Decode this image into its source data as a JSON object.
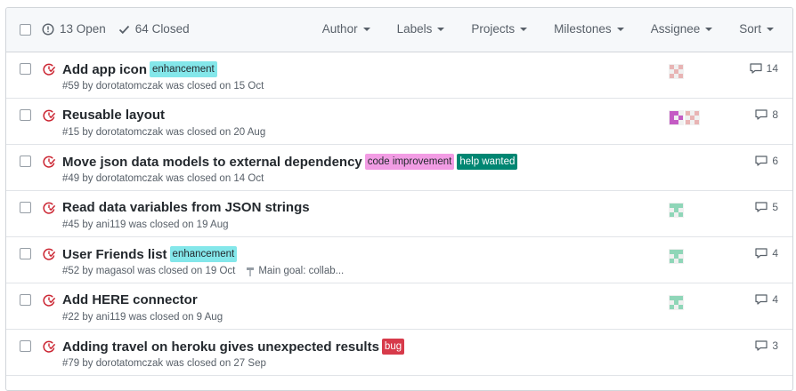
{
  "header": {
    "open_label": "13 Open",
    "closed_label": "64 Closed",
    "filters": [
      "Author",
      "Labels",
      "Projects",
      "Milestones",
      "Assignee",
      "Sort"
    ]
  },
  "colors": {
    "closed_icon": "#cb2431",
    "enhancement": "#84e7ea",
    "code_improvement": "#f29ce4",
    "help_wanted": "#008672",
    "bug": "#d73a4a"
  },
  "issues": [
    {
      "title": "Add app icon",
      "labels": [
        {
          "text": "enhancement",
          "bg": "#84e7ea",
          "fg": "#24292e"
        }
      ],
      "meta": "#59 by dorotatomczak was closed on 15 Oct",
      "milestone": "",
      "assignees": [
        "rose-identicon"
      ],
      "comments": "14"
    },
    {
      "title": "Reusable layout",
      "labels": [],
      "meta": "#15 by dorotatomczak was closed on 20 Aug",
      "milestone": "",
      "assignees": [
        "purple-identicon",
        "rose-identicon"
      ],
      "comments": "8"
    },
    {
      "title": "Move json data models to external dependency",
      "labels": [
        {
          "text": "code improvement",
          "bg": "#f29ce4",
          "fg": "#24292e"
        },
        {
          "text": "help wanted",
          "bg": "#008672",
          "fg": "#ffffff"
        }
      ],
      "meta": "#49 by dorotatomczak was closed on 14 Oct",
      "milestone": "",
      "assignees": [],
      "comments": "6"
    },
    {
      "title": "Read data variables from JSON strings",
      "labels": [],
      "meta": "#45 by ani119 was closed on 19 Aug",
      "milestone": "",
      "assignees": [
        "mint-identicon"
      ],
      "comments": "5"
    },
    {
      "title": "User Friends list",
      "labels": [
        {
          "text": "enhancement",
          "bg": "#84e7ea",
          "fg": "#24292e"
        }
      ],
      "meta": "#52 by magasol was closed on 19 Oct",
      "milestone": "Main goal: collab...",
      "assignees": [
        "mint-identicon"
      ],
      "comments": "4"
    },
    {
      "title": "Add HERE connector",
      "labels": [],
      "meta": "#22 by ani119 was closed on 9 Aug",
      "milestone": "",
      "assignees": [
        "mint-identicon"
      ],
      "comments": "4"
    },
    {
      "title": "Adding travel on heroku gives unexpected results",
      "labels": [
        {
          "text": "bug",
          "bg": "#d73a4a",
          "fg": "#ffffff"
        }
      ],
      "meta": "#79 by dorotatomczak was closed on 27 Sep",
      "milestone": "",
      "assignees": [],
      "comments": "3"
    }
  ]
}
